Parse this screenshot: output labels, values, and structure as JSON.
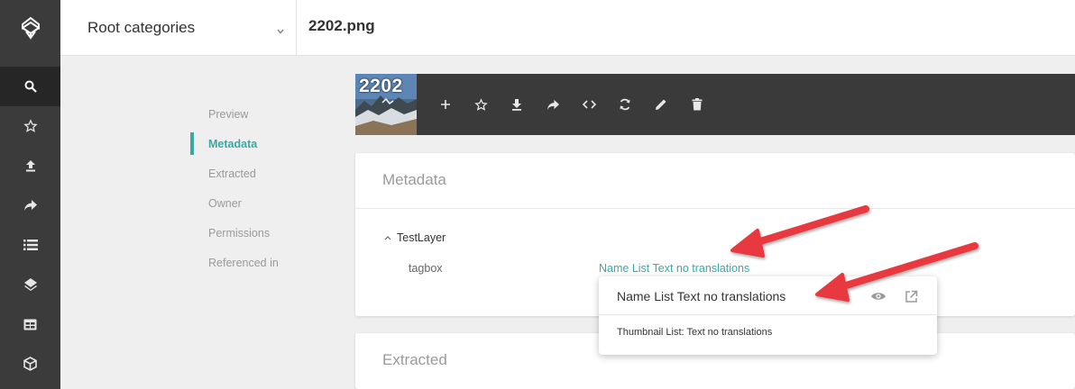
{
  "header": {
    "category_select": "Root categories",
    "file_title": "2202.png"
  },
  "rail": {
    "items": [
      {
        "icon": "search-icon"
      },
      {
        "icon": "star-icon"
      },
      {
        "icon": "upload-icon"
      },
      {
        "icon": "share-icon"
      },
      {
        "icon": "list-icon"
      },
      {
        "icon": "layers-icon"
      },
      {
        "icon": "table-icon"
      },
      {
        "icon": "cube-icon"
      }
    ]
  },
  "sidenav": {
    "items": [
      "Preview",
      "Metadata",
      "Extracted",
      "Owner",
      "Permissions",
      "Referenced in"
    ],
    "active": "Metadata"
  },
  "toolbar": {
    "thumbnail_label": "2202"
  },
  "metadata": {
    "title": "Metadata",
    "layer": "TestLayer",
    "field_name": "tagbox",
    "field_value": "Name List Text no translations"
  },
  "popover": {
    "title": "Name List Text no translations",
    "description": "Thumbnail List: Text no translations"
  },
  "extracted": {
    "title": "Extracted"
  },
  "colors": {
    "accent": "#3aa9a3",
    "rail": "#3b3b3b",
    "toolbar": "#3a3a3a",
    "arrow": "#e8393f"
  }
}
